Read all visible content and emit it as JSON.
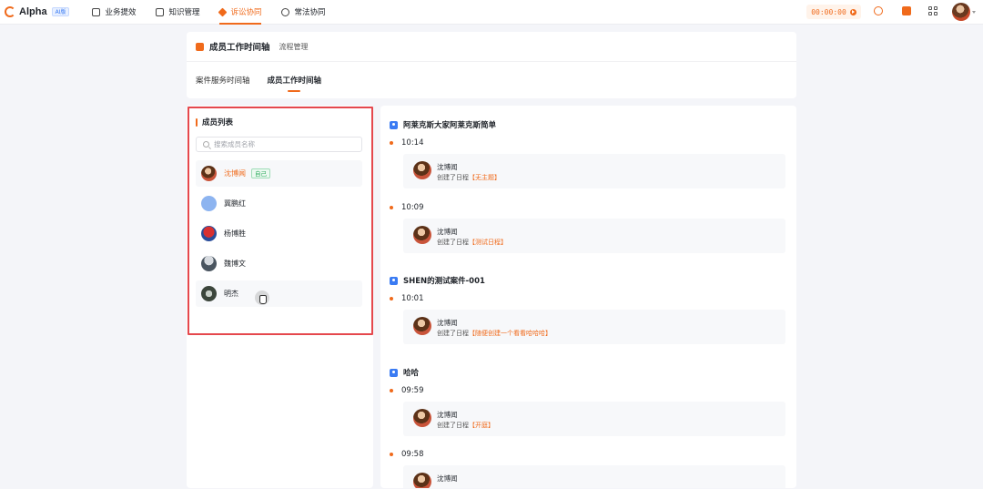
{
  "app": {
    "logo_text": "Alpha",
    "badge": "AI版"
  },
  "nav": [
    {
      "label": "业务提效",
      "icon": "calendar-icon"
    },
    {
      "label": "知识管理",
      "icon": "book-icon"
    },
    {
      "label": "诉讼协同",
      "icon": "litigation-icon",
      "active": true
    },
    {
      "label": "常法协同",
      "icon": "shield-icon"
    }
  ],
  "topbar": {
    "timer": "00:00:00"
  },
  "page": {
    "title": "成员工作时间轴",
    "subtitle": "流程管理",
    "tabs": [
      "案件服务时间轴",
      "成员工作时间轴"
    ],
    "active_tab": 1
  },
  "members": {
    "title": "成员列表",
    "search_placeholder": "搜索成员名称",
    "self_tag": "自己",
    "items": [
      {
        "name": "沈博闻",
        "self": true
      },
      {
        "name": "冀鹏红"
      },
      {
        "name": "杨博胜"
      },
      {
        "name": "魏博文"
      },
      {
        "name": "明杰"
      }
    ]
  },
  "timeline": [
    {
      "case": "阿莱克斯大家阿莱克斯简单",
      "entries": [
        {
          "time": "10:14",
          "user": "沈博闻",
          "action": "创建了日程",
          "target": "【无主题】"
        },
        {
          "time": "10:09",
          "user": "沈博闻",
          "action": "创建了日程",
          "target": "【测试日程】"
        }
      ]
    },
    {
      "case": "SHEN的测试案件-001",
      "entries": [
        {
          "time": "10:01",
          "user": "沈博闻",
          "action": "创建了日程",
          "target": "【随便创建一个看看哈哈哈】"
        }
      ]
    },
    {
      "case": "哈哈",
      "entries": [
        {
          "time": "09:59",
          "user": "沈博闻",
          "action": "创建了日程",
          "target": "【开庭】"
        },
        {
          "time": "09:58",
          "user": "沈博闻",
          "action": "",
          "target": ""
        }
      ]
    }
  ]
}
